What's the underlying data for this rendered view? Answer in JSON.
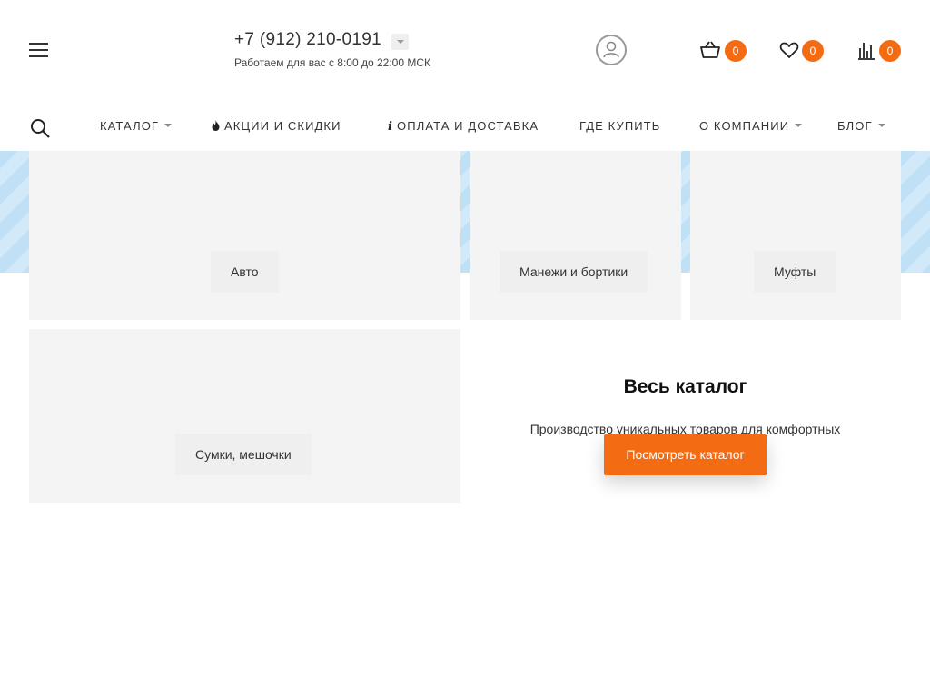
{
  "header": {
    "phone": "+7 (912) 210-0191",
    "work_hours": "Работаем для вас с 8:00 до 22:00 МСК",
    "cart_count": "0",
    "wishlist_count": "0",
    "compare_count": "0",
    "accent_color": "#f36c13"
  },
  "nav": {
    "items": [
      {
        "label": "КАТАЛОГ",
        "has_dropdown": true
      },
      {
        "label": "АКЦИИ И СКИДКИ",
        "icon": "fire-icon"
      },
      {
        "label": "ОПЛАТА И ДОСТАВКА",
        "icon": "info-icon"
      },
      {
        "label": "ГДЕ КУПИТЬ"
      },
      {
        "label": "О КОМПАНИИ",
        "has_dropdown": true
      },
      {
        "label": "БЛОГ",
        "has_dropdown": true
      }
    ]
  },
  "categories": [
    {
      "label": "Авто"
    },
    {
      "label": "Манежи и бортики"
    },
    {
      "label": "Муфты"
    },
    {
      "label": "Сумки, мешочки"
    }
  ],
  "catalog": {
    "title": "Весь каталог",
    "description": "Производство уникальных товаров для комфортных",
    "button_label": "Посмотреть каталог"
  }
}
